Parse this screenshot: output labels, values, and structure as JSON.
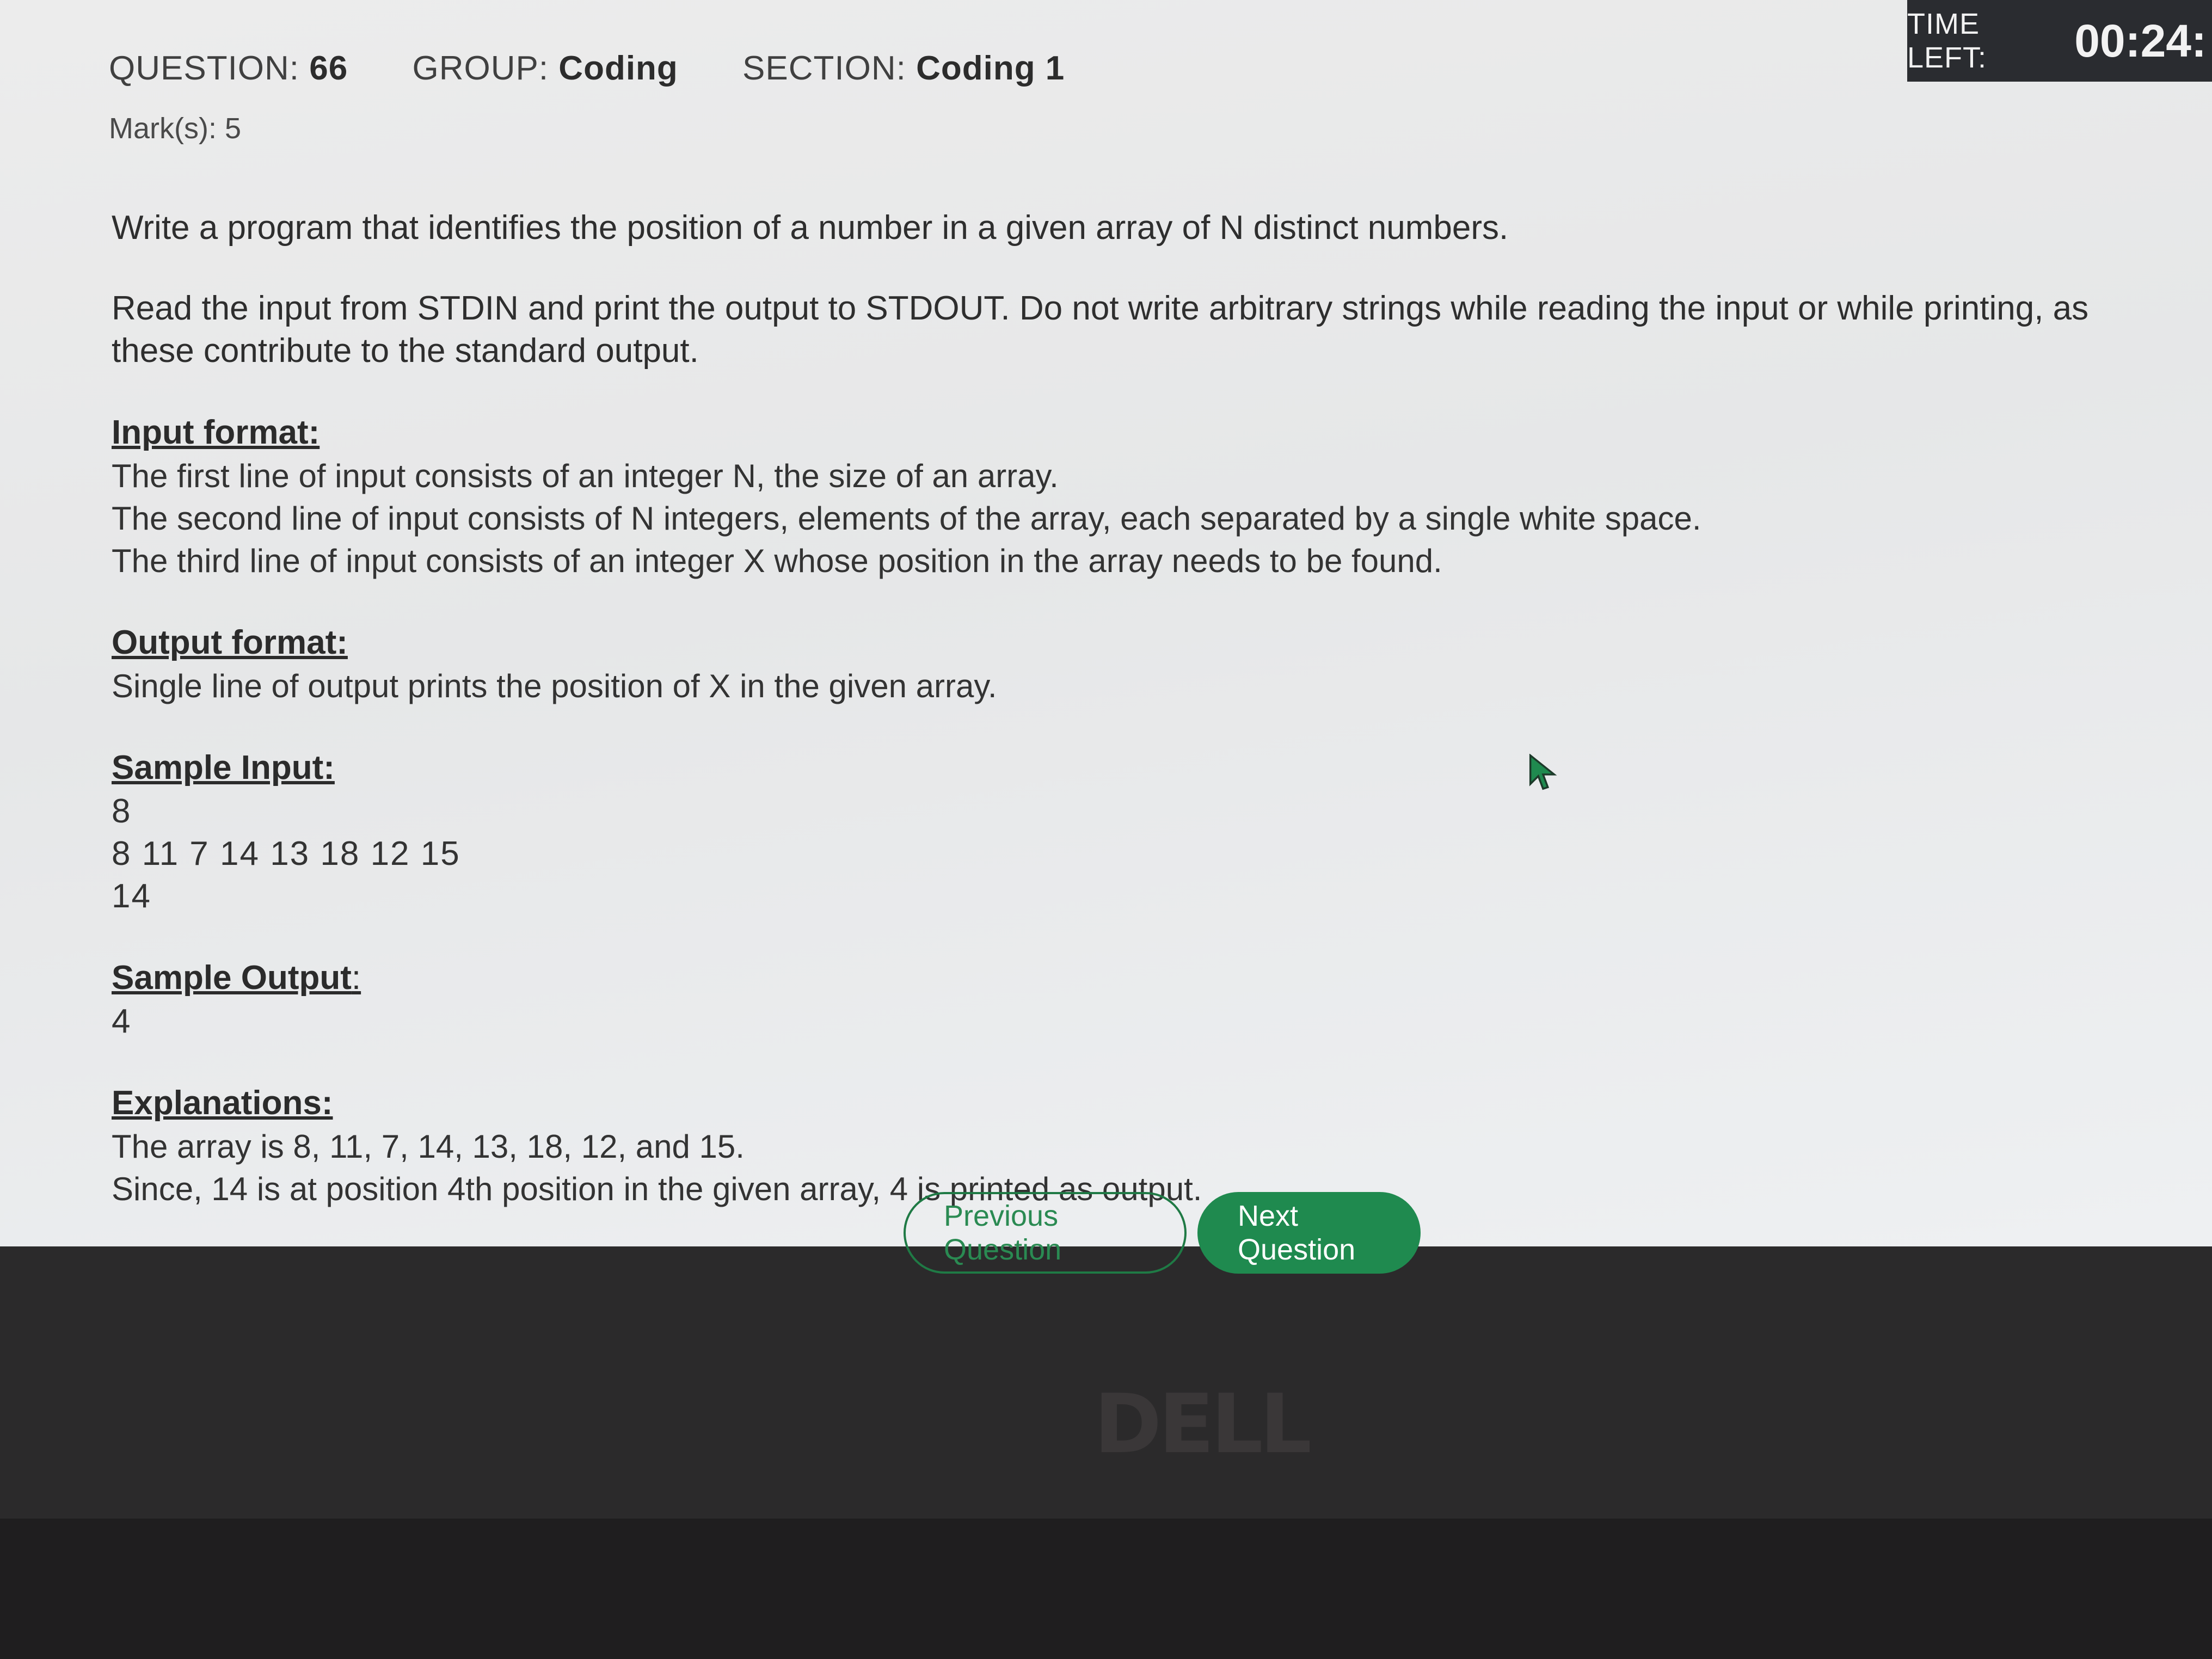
{
  "header": {
    "question_label": "QUESTION:",
    "question_value": "66",
    "group_label": "GROUP:",
    "group_value": "Coding",
    "section_label": "SECTION:",
    "section_value": "Coding 1",
    "marks": "Mark(s): 5",
    "timer_label": "TIME LEFT:",
    "timer_value": "00:24:"
  },
  "problem": {
    "statement": "Write a program that identifies the position of a number in a given array of N distinct numbers.",
    "io_note": "Read the input from STDIN and print the output to STDOUT. Do not write arbitrary strings while reading the input or while printing, as these contribute to the standard output.",
    "input_format": {
      "heading": "Input format:",
      "lines": [
        "The first line of input consists of an integer N, the size of an array.",
        "The second line of input consists of N integers, elements of the array, each separated by a single white space.",
        "The third line of input consists of an integer X whose position in the array needs to be found."
      ]
    },
    "output_format": {
      "heading": "Output format:",
      "lines": [
        "Single line of output prints the position of X in the given array."
      ]
    },
    "sample_input": {
      "heading": "Sample Input:",
      "lines": [
        "8",
        "8 11 7 14 13 18 12 15",
        "14"
      ]
    },
    "sample_output": {
      "heading": "Sample Output",
      "lines": [
        "4"
      ]
    },
    "explanations": {
      "heading": "Explanations:",
      "lines": [
        "The array is 8, 11, 7, 14, 13, 18, 12, and 15.",
        "Since, 14 is at position 4th position in the given array, 4 is printed as output."
      ]
    }
  },
  "navigation": {
    "prev_label": "Previous Question",
    "next_label": "Next Question"
  },
  "bezel": {
    "brand": "DELL"
  },
  "colors": {
    "accent_green": "#1f8a4f",
    "timer_bg": "#2a2c30"
  }
}
